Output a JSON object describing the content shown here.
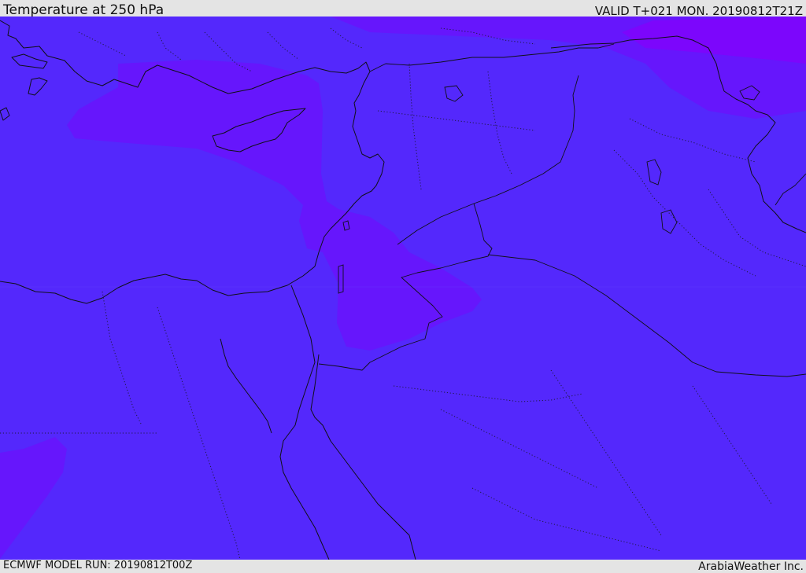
{
  "header": {
    "title": "Temperature at 250 hPa",
    "valid": "VALID T+021 MON. 20190812T21Z"
  },
  "footer": {
    "model_run": "ECMWF MODEL RUN: 20190812T00Z",
    "brand": "ArabiaWeather Inc."
  },
  "map": {
    "colors": {
      "base": "#5428fc",
      "cool": "#6616fc",
      "cold": "#7c06fc",
      "coast": "#101018"
    }
  }
}
